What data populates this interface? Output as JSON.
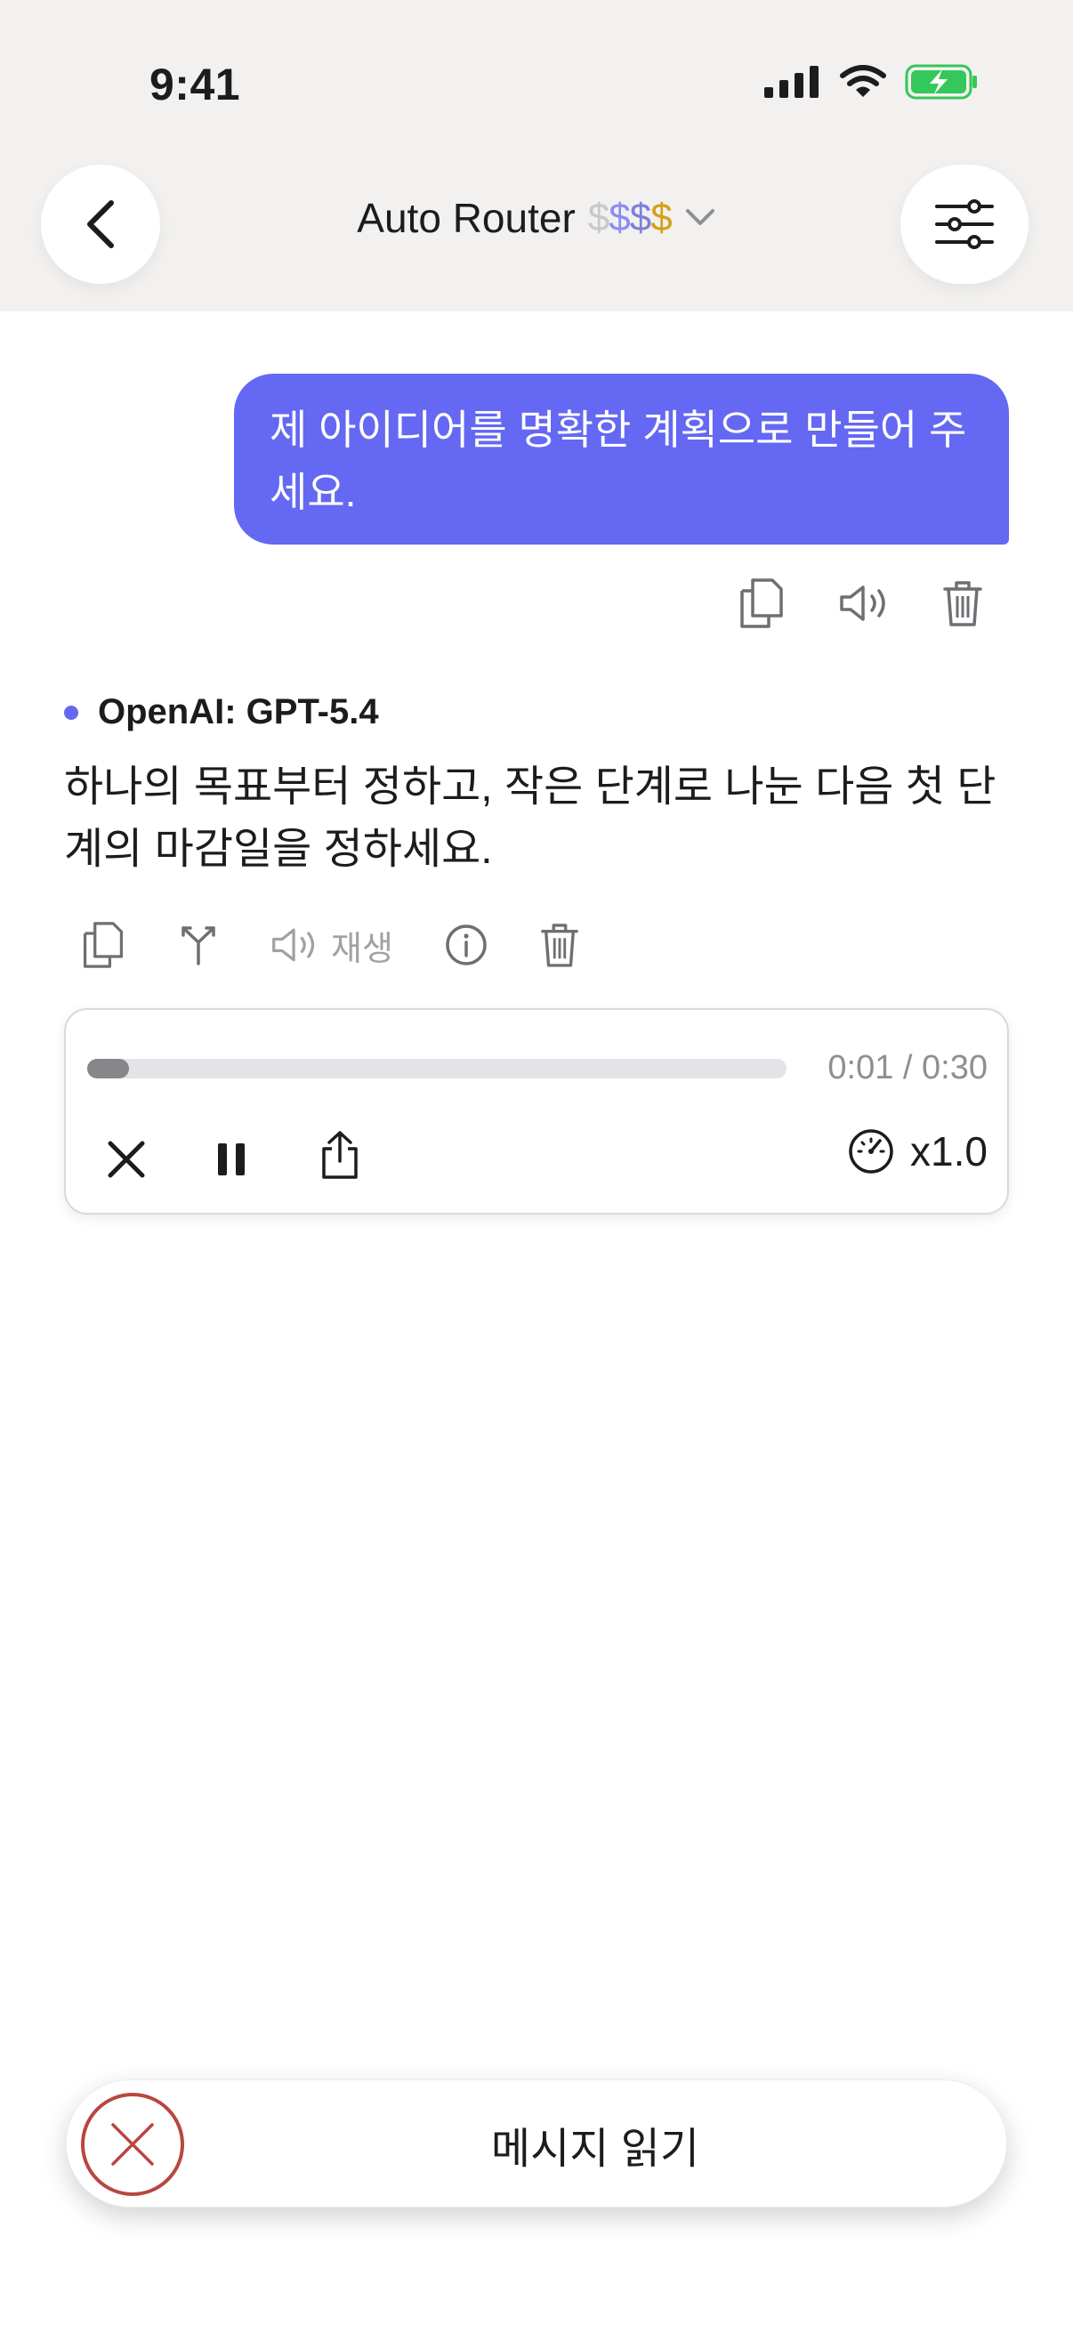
{
  "status_bar": {
    "time": "9:41"
  },
  "header": {
    "title": "Auto Router",
    "price_symbols": [
      {
        "char": "$",
        "color": "#c7c7cc"
      },
      {
        "char": "$",
        "color": "#8a8df5"
      },
      {
        "char": "$",
        "color": "#7c7fd9"
      },
      {
        "char": "$",
        "color": "#d4a017"
      }
    ]
  },
  "user_message": {
    "text": "제 아이디어를 명확한 계획으로 만들어 주세요."
  },
  "assistant": {
    "model": "OpenAI: GPT-5.4",
    "text": "하나의 목표부터 정하고, 작은 단계로 나눈 다음 첫 단계의 마감일을 정하세요.",
    "play_label": "재생"
  },
  "player": {
    "progress": 0.06,
    "time": "0:01 / 0:30",
    "speed": "x1.0"
  },
  "bottom_bar": {
    "label": "메시지 읽기"
  },
  "colors": {
    "accent": "#6468f2",
    "stop": "#b9463f",
    "icon_gray": "#6e6e73",
    "icon_light": "#a1a1a6"
  }
}
